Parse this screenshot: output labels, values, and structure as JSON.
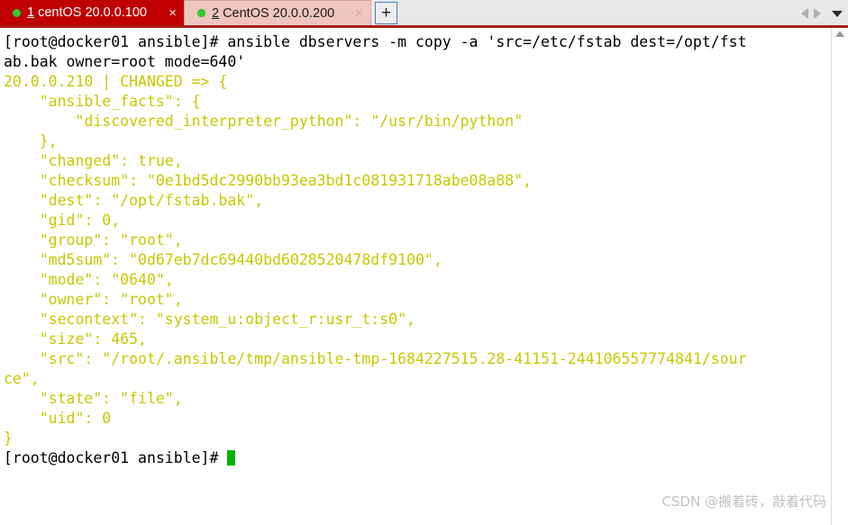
{
  "window": {
    "title": "CentOS Terminal - ansible copy module",
    "accent_red": "#c00000",
    "tab_border_red": "#a81c16",
    "terminal_yellow": "#c8c800",
    "terminal_black": "#000000",
    "cursor_green": "#00b400",
    "tab_dot_green": "#2ecc2e",
    "inactive_tab_pink": "#efc5c0",
    "new_tab_border_blue": "#4a7ebb"
  },
  "tabs": [
    {
      "index": "1",
      "label": "centOS 20.0.0.100",
      "close_label": "×",
      "active": true,
      "status_icon": "connected-dot-icon"
    },
    {
      "index": "2",
      "label": "CentOS 20.0.0.200",
      "close_label": "×",
      "active": false,
      "status_icon": "connected-dot-icon"
    }
  ],
  "tab_bar": {
    "new_tab_label": "+",
    "prev_tab_icon": "chevron-left-icon",
    "next_tab_icon": "chevron-right-icon",
    "tab_list_icon": "chevron-down-icon"
  },
  "scrollbar": {
    "up_arrow_icon": "scroll-up-arrow-icon"
  },
  "terminal": {
    "lines": [
      {
        "text": "[root@docker01 ansible]# ansible dbservers -m copy -a 'src=/etc/fstab dest=/opt/fst",
        "color": "black"
      },
      {
        "text": "ab.bak owner=root mode=640'",
        "color": "black"
      },
      {
        "text": "20.0.0.210 | CHANGED => {",
        "color": "yellow"
      },
      {
        "text": "    \"ansible_facts\": {",
        "color": "yellow"
      },
      {
        "text": "        \"discovered_interpreter_python\": \"/usr/bin/python\"",
        "color": "yellow"
      },
      {
        "text": "    },",
        "color": "yellow"
      },
      {
        "text": "    \"changed\": true,",
        "color": "yellow"
      },
      {
        "text": "    \"checksum\": \"0e1bd5dc2990bb93ea3bd1c081931718abe08a88\",",
        "color": "yellow"
      },
      {
        "text": "    \"dest\": \"/opt/fstab.bak\",",
        "color": "yellow"
      },
      {
        "text": "    \"gid\": 0,",
        "color": "yellow"
      },
      {
        "text": "    \"group\": \"root\",",
        "color": "yellow"
      },
      {
        "text": "    \"md5sum\": \"0d67eb7dc69440bd6028520478df9100\",",
        "color": "yellow"
      },
      {
        "text": "    \"mode\": \"0640\",",
        "color": "yellow"
      },
      {
        "text": "    \"owner\": \"root\",",
        "color": "yellow"
      },
      {
        "text": "    \"secontext\": \"system_u:object_r:usr_t:s0\",",
        "color": "yellow"
      },
      {
        "text": "    \"size\": 465,",
        "color": "yellow"
      },
      {
        "text": "    \"src\": \"/root/.ansible/tmp/ansible-tmp-1684227515.28-41151-244106557774841/sour",
        "color": "yellow"
      },
      {
        "text": "ce\",",
        "color": "yellow"
      },
      {
        "text": "    \"state\": \"file\",",
        "color": "yellow"
      },
      {
        "text": "    \"uid\": 0",
        "color": "yellow"
      },
      {
        "text": "}",
        "color": "yellow"
      },
      {
        "text": "[root@docker01 ansible]# ",
        "color": "black",
        "cursor": true
      }
    ]
  },
  "watermark": {
    "text": "CSDN @搬着砖，敲着代码"
  }
}
